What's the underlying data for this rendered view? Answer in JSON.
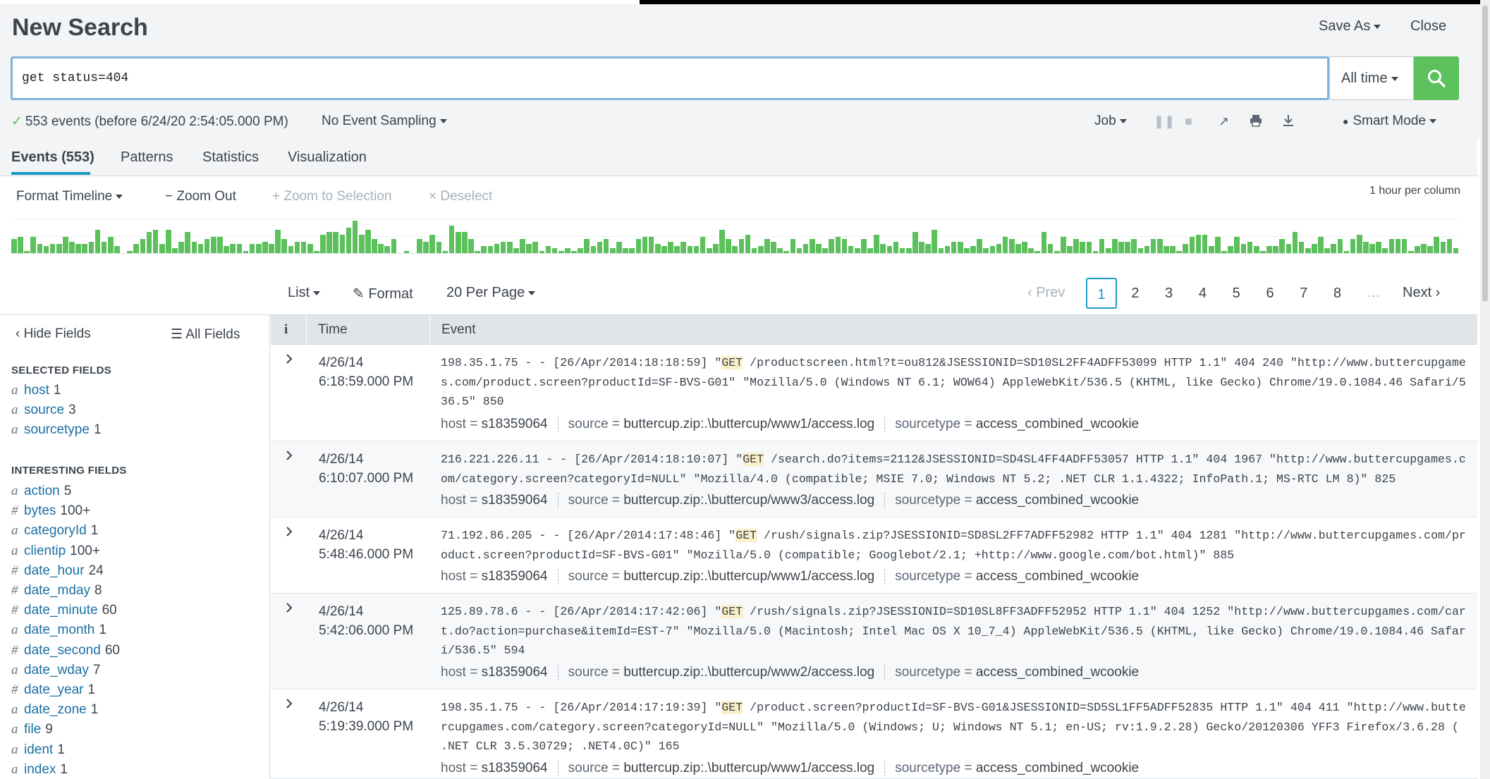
{
  "header": {
    "title": "New Search",
    "save_as": "Save As",
    "close": "Close"
  },
  "search": {
    "query": "get status=404",
    "time_range": "All time"
  },
  "status": {
    "events_text": "553 events (before 6/24/20 2:54:05.000 PM)",
    "sampling": "No Event Sampling",
    "job": "Job",
    "mode": "Smart Mode"
  },
  "tabs": [
    {
      "label": "Events (553)"
    },
    {
      "label": "Patterns"
    },
    {
      "label": "Statistics"
    },
    {
      "label": "Visualization"
    }
  ],
  "timeline": {
    "format": "Format Timeline",
    "zoom_out": "Zoom Out",
    "zoom_selection": "Zoom to Selection",
    "deselect": "Deselect",
    "per_column": "1 hour per column",
    "bars": [
      6,
      7,
      1,
      7,
      4,
      3,
      4,
      4,
      7,
      5,
      4,
      4,
      5,
      10,
      5,
      7,
      3,
      0,
      1,
      4,
      6,
      9,
      10,
      4,
      10,
      2,
      5,
      9,
      5,
      4,
      6,
      7,
      7,
      3,
      4,
      4,
      1,
      4,
      4,
      5,
      4,
      10,
      6,
      3,
      5,
      5,
      4,
      1,
      8,
      9,
      9,
      8,
      11,
      14,
      8,
      10,
      6,
      4,
      3,
      6,
      0,
      1,
      0,
      6,
      5,
      8,
      5,
      1,
      12,
      9,
      9,
      6,
      1,
      3,
      3,
      4,
      5,
      5,
      2,
      6,
      4,
      5,
      1,
      3,
      2,
      1,
      2,
      1,
      2,
      6,
      3,
      5,
      6,
      2,
      5,
      2,
      2,
      6,
      7,
      7,
      4,
      3,
      5,
      3,
      5,
      3,
      3,
      7,
      2,
      4,
      10,
      6,
      3,
      6,
      8,
      2,
      3,
      6,
      5,
      2,
      1,
      6,
      2,
      4,
      6,
      4,
      2,
      6,
      7,
      6,
      3,
      2,
      6,
      2,
      8,
      4,
      3,
      5,
      2,
      2,
      9,
      5,
      4,
      10,
      2,
      3,
      5,
      5,
      2,
      3,
      6,
      2,
      3,
      4,
      7,
      6,
      4,
      5,
      2,
      1,
      9,
      4,
      1,
      7,
      3,
      6,
      5,
      5,
      1,
      6,
      2,
      6,
      5,
      5,
      6,
      2,
      3,
      6,
      6,
      3,
      3,
      1,
      4,
      7,
      8,
      8,
      3,
      7,
      1,
      3,
      7,
      4,
      5,
      3,
      1,
      3,
      3,
      6,
      4,
      9,
      5,
      2,
      4,
      7,
      2,
      4,
      6,
      1,
      6,
      8,
      5,
      4,
      5,
      2,
      6,
      6,
      6,
      1,
      3,
      4,
      3,
      7,
      5,
      6,
      2
    ]
  },
  "pager": {
    "view": "List",
    "format": "Format",
    "per_page": "20 Per Page",
    "prev": "Prev",
    "pages": [
      "1",
      "2",
      "3",
      "4",
      "5",
      "6",
      "7",
      "8"
    ],
    "ellipsis": "…",
    "next": "Next"
  },
  "sidebar": {
    "hide_fields": "Hide Fields",
    "all_fields": "All Fields",
    "selected_heading": "SELECTED FIELDS",
    "selected": [
      {
        "type": "a",
        "name": "host",
        "count": "1"
      },
      {
        "type": "a",
        "name": "source",
        "count": "3"
      },
      {
        "type": "a",
        "name": "sourcetype",
        "count": "1"
      }
    ],
    "interesting_heading": "INTERESTING FIELDS",
    "interesting": [
      {
        "type": "a",
        "name": "action",
        "count": "5"
      },
      {
        "type": "#",
        "name": "bytes",
        "count": "100+"
      },
      {
        "type": "a",
        "name": "categoryId",
        "count": "1"
      },
      {
        "type": "a",
        "name": "clientip",
        "count": "100+"
      },
      {
        "type": "#",
        "name": "date_hour",
        "count": "24"
      },
      {
        "type": "#",
        "name": "date_mday",
        "count": "8"
      },
      {
        "type": "#",
        "name": "date_minute",
        "count": "60"
      },
      {
        "type": "a",
        "name": "date_month",
        "count": "1"
      },
      {
        "type": "#",
        "name": "date_second",
        "count": "60"
      },
      {
        "type": "a",
        "name": "date_wday",
        "count": "7"
      },
      {
        "type": "#",
        "name": "date_year",
        "count": "1"
      },
      {
        "type": "a",
        "name": "date_zone",
        "count": "1"
      },
      {
        "type": "a",
        "name": "file",
        "count": "9"
      },
      {
        "type": "a",
        "name": "ident",
        "count": "1"
      },
      {
        "type": "a",
        "name": "index",
        "count": "1"
      }
    ]
  },
  "table": {
    "col_info": "i",
    "col_time": "Time",
    "col_event": "Event",
    "events": [
      {
        "date": "4/26/14",
        "time": "6:18:59.000 PM",
        "pre": "198.35.1.75 - - [26/Apr/2014:18:18:59] \"",
        "method": "GET",
        "post": " /productscreen.html?t=ou812&JSESSIONID=SD10SL2FF4ADFF53099 HTTP 1.1\" 404 240 \"http://www.buttercupgames.com/product.screen?productId=SF-BVS-G01\" \"Mozilla/5.0 (Windows NT 6.1; WOW64) AppleWebKit/536.5 (KHTML, like Gecko) Chrome/19.0.1084.46 Safari/536.5\" 850",
        "host": "s18359064",
        "source": "buttercup.zip:.\\buttercup/www1/access.log",
        "sourcetype": "access_combined_wcookie"
      },
      {
        "date": "4/26/14",
        "time": "6:10:07.000 PM",
        "pre": "216.221.226.11 - - [26/Apr/2014:18:10:07] \"",
        "method": "GET",
        "post": " /search.do?items=2112&JSESSIONID=SD4SL4FF4ADFF53057 HTTP 1.1\" 404 1967 \"http://www.buttercupgames.com/category.screen?categoryId=NULL\" \"Mozilla/4.0 (compatible; MSIE 7.0; Windows NT 5.2; .NET CLR 1.1.4322; InfoPath.1; MS-RTC LM 8)\" 825",
        "host": "s18359064",
        "source": "buttercup.zip:.\\buttercup/www3/access.log",
        "sourcetype": "access_combined_wcookie"
      },
      {
        "date": "4/26/14",
        "time": "5:48:46.000 PM",
        "pre": "71.192.86.205 - - [26/Apr/2014:17:48:46] \"",
        "method": "GET",
        "post": " /rush/signals.zip?JSESSIONID=SD8SL2FF7ADFF52982 HTTP 1.1\" 404 1281 \"http://www.buttercupgames.com/product.screen?productId=SF-BVS-G01\" \"Mozilla/5.0 (compatible; Googlebot/2.1; +http://www.google.com/bot.html)\" 885",
        "host": "s18359064",
        "source": "buttercup.zip:.\\buttercup/www1/access.log",
        "sourcetype": "access_combined_wcookie"
      },
      {
        "date": "4/26/14",
        "time": "5:42:06.000 PM",
        "pre": "125.89.78.6 - - [26/Apr/2014:17:42:06] \"",
        "method": "GET",
        "post": " /rush/signals.zip?JSESSIONID=SD10SL8FF3ADFF52952 HTTP 1.1\" 404 1252 \"http://www.buttercupgames.com/cart.do?action=purchase&itemId=EST-7\" \"Mozilla/5.0 (Macintosh; Intel Mac OS X 10_7_4) AppleWebKit/536.5 (KHTML, like Gecko) Chrome/19.0.1084.46 Safari/536.5\" 594",
        "host": "s18359064",
        "source": "buttercup.zip:.\\buttercup/www2/access.log",
        "sourcetype": "access_combined_wcookie"
      },
      {
        "date": "4/26/14",
        "time": "5:19:39.000 PM",
        "pre": "198.35.1.75 - - [26/Apr/2014:17:19:39] \"",
        "method": "GET",
        "post": " /product.screen?productId=SF-BVS-G01&JSESSIONID=SD5SL1FF5ADFF52835 HTTP 1.1\" 404 411 \"http://www.buttercupgames.com/category.screen?categoryId=NULL\" \"Mozilla/5.0 (Windows; U; Windows NT 5.1; en-US; rv:1.9.2.28) Gecko/20120306 YFF3 Firefox/3.6.28 ( .NET CLR 3.5.30729; .NET4.0C)\" 165",
        "host": "s18359064",
        "source": "buttercup.zip:.\\buttercup/www1/access.log",
        "sourcetype": "access_combined_wcookie"
      }
    ]
  },
  "colors": {
    "accent_green": "#5cc05c",
    "link_blue": "#1a6fa3",
    "tab_accent": "#1a9cc6"
  }
}
